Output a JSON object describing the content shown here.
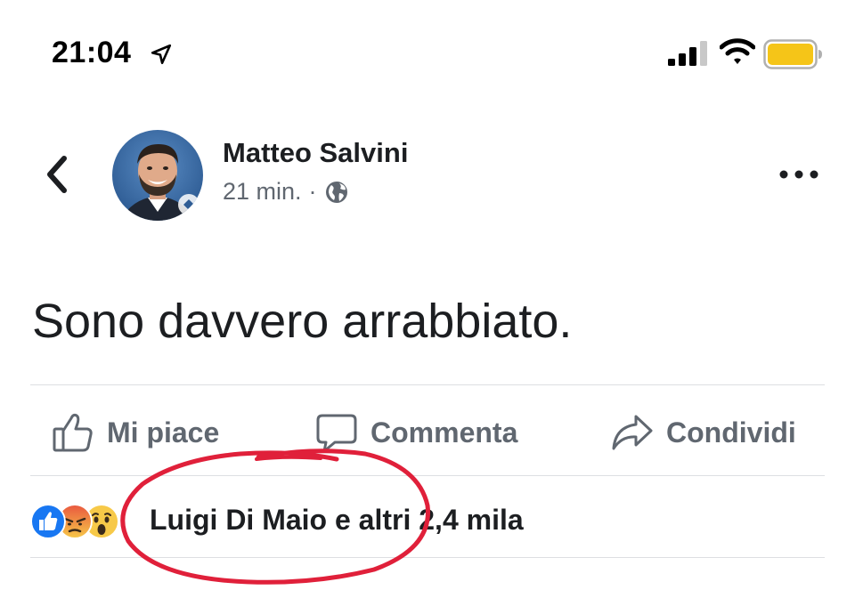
{
  "status_bar": {
    "time": "21:04",
    "icons": [
      "location-arrow-icon",
      "cellular-signal-icon",
      "wifi-icon",
      "battery-icon"
    ],
    "battery_color": "#f5c518"
  },
  "post": {
    "author": "Matteo Salvini",
    "time_ago": "21 min.",
    "separator": "·",
    "privacy_icon": "globe-icon",
    "text": "Sono davvero arrabbiato."
  },
  "actions": {
    "like_label": "Mi piace",
    "comment_label": "Commenta",
    "share_label": "Condividi"
  },
  "reactions": {
    "icons": [
      "like-reaction-icon",
      "angry-reaction-icon",
      "wow-reaction-icon"
    ],
    "summary": "Luigi Di Maio e altri 2,4 mila"
  },
  "colors": {
    "text_primary": "#1c1e21",
    "text_secondary": "#606770",
    "like_blue": "#1877f2",
    "annotation_red": "#e0203a"
  }
}
